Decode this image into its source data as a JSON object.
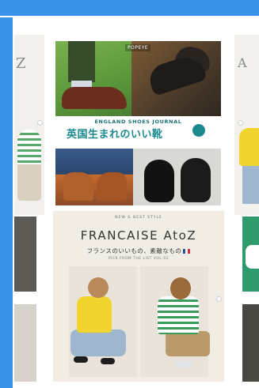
{
  "colors": {
    "frame_blue": "#3b93e9",
    "frame_line": "#ffffff",
    "england_title": "#1a8a8f",
    "francaise_text": "#333333"
  },
  "tiles": {
    "left_top": {
      "title_fragment": "Z"
    },
    "right_top": {
      "title_fragment": "A"
    },
    "england": {
      "logo": "POPEYE",
      "subtitle": "ENGLAND SHOES JOURNAL",
      "title": "英国生まれのいい靴"
    },
    "francaise": {
      "kicker": "NEW & BEST STYLE",
      "title": "FRANCAISE AtoZ",
      "subtitle": "フランスのいいもの、素敵なもの",
      "tagline": "PICK FROM THE LIST VOL.02"
    }
  }
}
